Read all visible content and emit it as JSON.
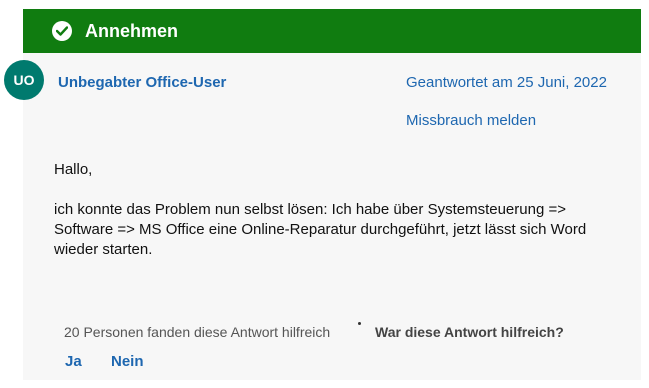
{
  "banner": {
    "icon": "check-circle-icon",
    "label": "Annehmen",
    "color": "#107c10"
  },
  "author": {
    "initials": "UO",
    "name": "Unbegabter Office-User",
    "avatar_color": "#007a6e"
  },
  "meta": {
    "answered": "Geantwortet am 25 Juni, 2022",
    "report": "Missbrauch melden"
  },
  "post": {
    "greeting": "Hallo,",
    "body": "ich konnte das Problem nun selbst lösen: Ich habe über Systemsteuerung => Software => MS Office eine Online-Reparatur durchgeführt, jetzt lässt sich Word wieder starten."
  },
  "footer": {
    "helpful_count": "20 Personen fanden diese Antwort hilfreich",
    "question": "War diese Antwort hilfreich?",
    "yes": "Ja",
    "no": "Nein"
  }
}
